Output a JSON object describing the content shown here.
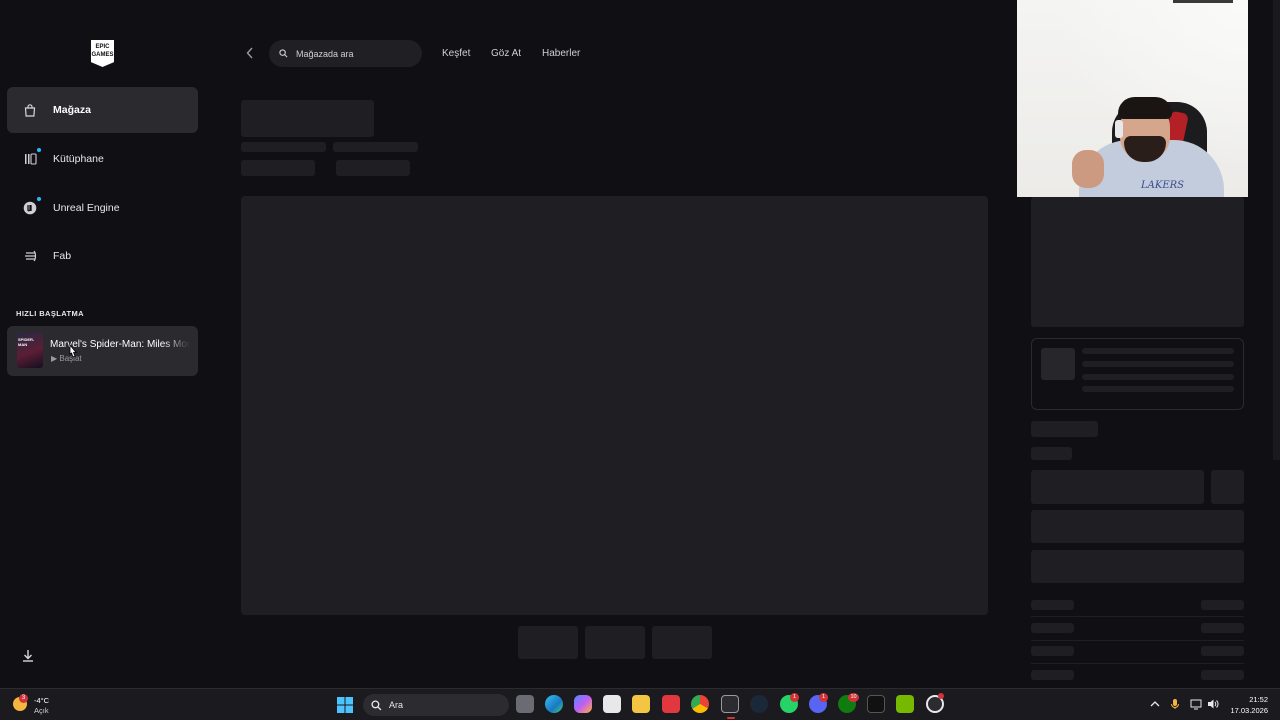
{
  "sidebar": {
    "logo_text": "EPIC GAMES",
    "items": [
      {
        "label": "Mağaza",
        "icon": "bag-icon",
        "active": true,
        "notification": false
      },
      {
        "label": "Kütüphane",
        "icon": "library-icon",
        "active": false,
        "notification": true
      },
      {
        "label": "Unreal Engine",
        "icon": "unreal-icon",
        "active": false,
        "notification": true
      },
      {
        "label": "Fab",
        "icon": "fab-icon",
        "active": false,
        "notification": false
      }
    ],
    "quick_launch_title": "HIZLI BAŞLATMA",
    "quick_launch": {
      "title": "Marvel's Spider-Man: Miles Morales",
      "action": "▶ Başlat",
      "thumb_text": "SPIDER-MAN"
    },
    "download_icon": "download-icon"
  },
  "topbar": {
    "search_placeholder": "Mağazada ara",
    "links": [
      "Keşfet",
      "Göz At",
      "Haberler"
    ]
  },
  "webcam": {
    "shirt_text": "LAKERS"
  },
  "colors": {
    "background": "#101014",
    "sidebar_active": "#2a2a2f",
    "skeleton": "#1f1f23",
    "notification_dot": "#26bbff",
    "badge_red": "#d13438"
  },
  "taskbar": {
    "weather": {
      "temp": "-4°C",
      "condition": "Açık",
      "badge": "3"
    },
    "search_label": "Ara",
    "apps": [
      {
        "name": "task-view-icon",
        "badge": ""
      },
      {
        "name": "edge-icon",
        "badge": ""
      },
      {
        "name": "copilot-icon",
        "badge": ""
      },
      {
        "name": "store-icon",
        "badge": ""
      },
      {
        "name": "file-explorer-icon",
        "badge": ""
      },
      {
        "name": "wps-icon",
        "badge": ""
      },
      {
        "name": "chrome-icon",
        "badge": ""
      },
      {
        "name": "epic-games-icon",
        "badge": ""
      },
      {
        "name": "steam-icon",
        "badge": ""
      },
      {
        "name": "whatsapp-icon",
        "badge": "1"
      },
      {
        "name": "discord-icon",
        "badge": "1"
      },
      {
        "name": "xbox-icon",
        "badge": "10"
      },
      {
        "name": "amazon-icon",
        "badge": ""
      },
      {
        "name": "nvidia-icon",
        "badge": ""
      },
      {
        "name": "obs-icon",
        "badge": ""
      }
    ],
    "clock": {
      "time": "21:52",
      "date": "17.03.2026"
    }
  }
}
